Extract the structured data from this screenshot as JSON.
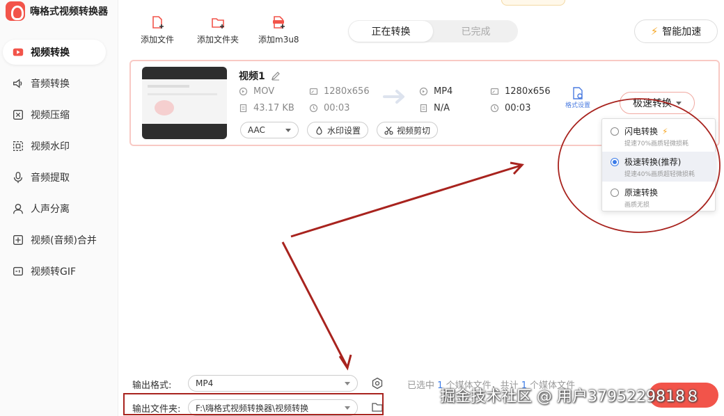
{
  "app": {
    "title": "嗨格式视频转换器"
  },
  "sidebar": {
    "items": [
      {
        "label": "视频转换",
        "icon": "video-convert-icon",
        "active": true
      },
      {
        "label": "音频转换",
        "icon": "audio-icon"
      },
      {
        "label": "视频压缩",
        "icon": "compress-icon"
      },
      {
        "label": "视频水印",
        "icon": "watermark-icon"
      },
      {
        "label": "音频提取",
        "icon": "mic-icon"
      },
      {
        "label": "人声分离",
        "icon": "person-icon"
      },
      {
        "label": "视频(音频)合并",
        "icon": "merge-icon"
      },
      {
        "label": "视频转GIF",
        "icon": "gif-icon"
      }
    ]
  },
  "toolbar": {
    "add_file": "添加文件",
    "add_folder": "添加文件夹",
    "add_m3u8": "添加m3u8",
    "tabs": [
      {
        "label": "正在转换",
        "active": true
      },
      {
        "label": "已完成",
        "active": false
      }
    ],
    "accel_label": "智能加速"
  },
  "file": {
    "name": "视频1",
    "source": {
      "format": "MOV",
      "resolution": "1280x656",
      "size": "43.17 KB",
      "duration": "00:03"
    },
    "target": {
      "format": "MP4",
      "resolution": "1280x656",
      "size": "N/A",
      "duration": "00:03"
    },
    "audio_codec": "AAC",
    "watermark_btn": "水印设置",
    "cut_btn": "视频剪切",
    "format_settings": "格式设置",
    "mode_btn": "极速转换"
  },
  "mode_menu": {
    "options": [
      {
        "label": "闪电转换",
        "desc": "提速70%画质轻微损耗",
        "selected": false,
        "bolt": true
      },
      {
        "label": "极速转换(推荐)",
        "desc": "提速40%画质超轻微损耗",
        "selected": true
      },
      {
        "label": "原速转换",
        "desc": "画质无损",
        "selected": false
      }
    ]
  },
  "output": {
    "format_label": "输出格式:",
    "format_value": "MP4",
    "folder_label": "输出文件夹:",
    "folder_value": "F:\\嗨格式视频转换器\\视频转换"
  },
  "status": {
    "prefix": "已选中",
    "selected": "1",
    "mid": "个媒体文件，共计",
    "total": "1",
    "suffix": "个媒体文件"
  },
  "watermark": "掘金技术社区 @ 用户3795229818８",
  "colors": {
    "accent": "#f2544a",
    "annotation": "#a8231e",
    "link": "#3b7be8"
  }
}
